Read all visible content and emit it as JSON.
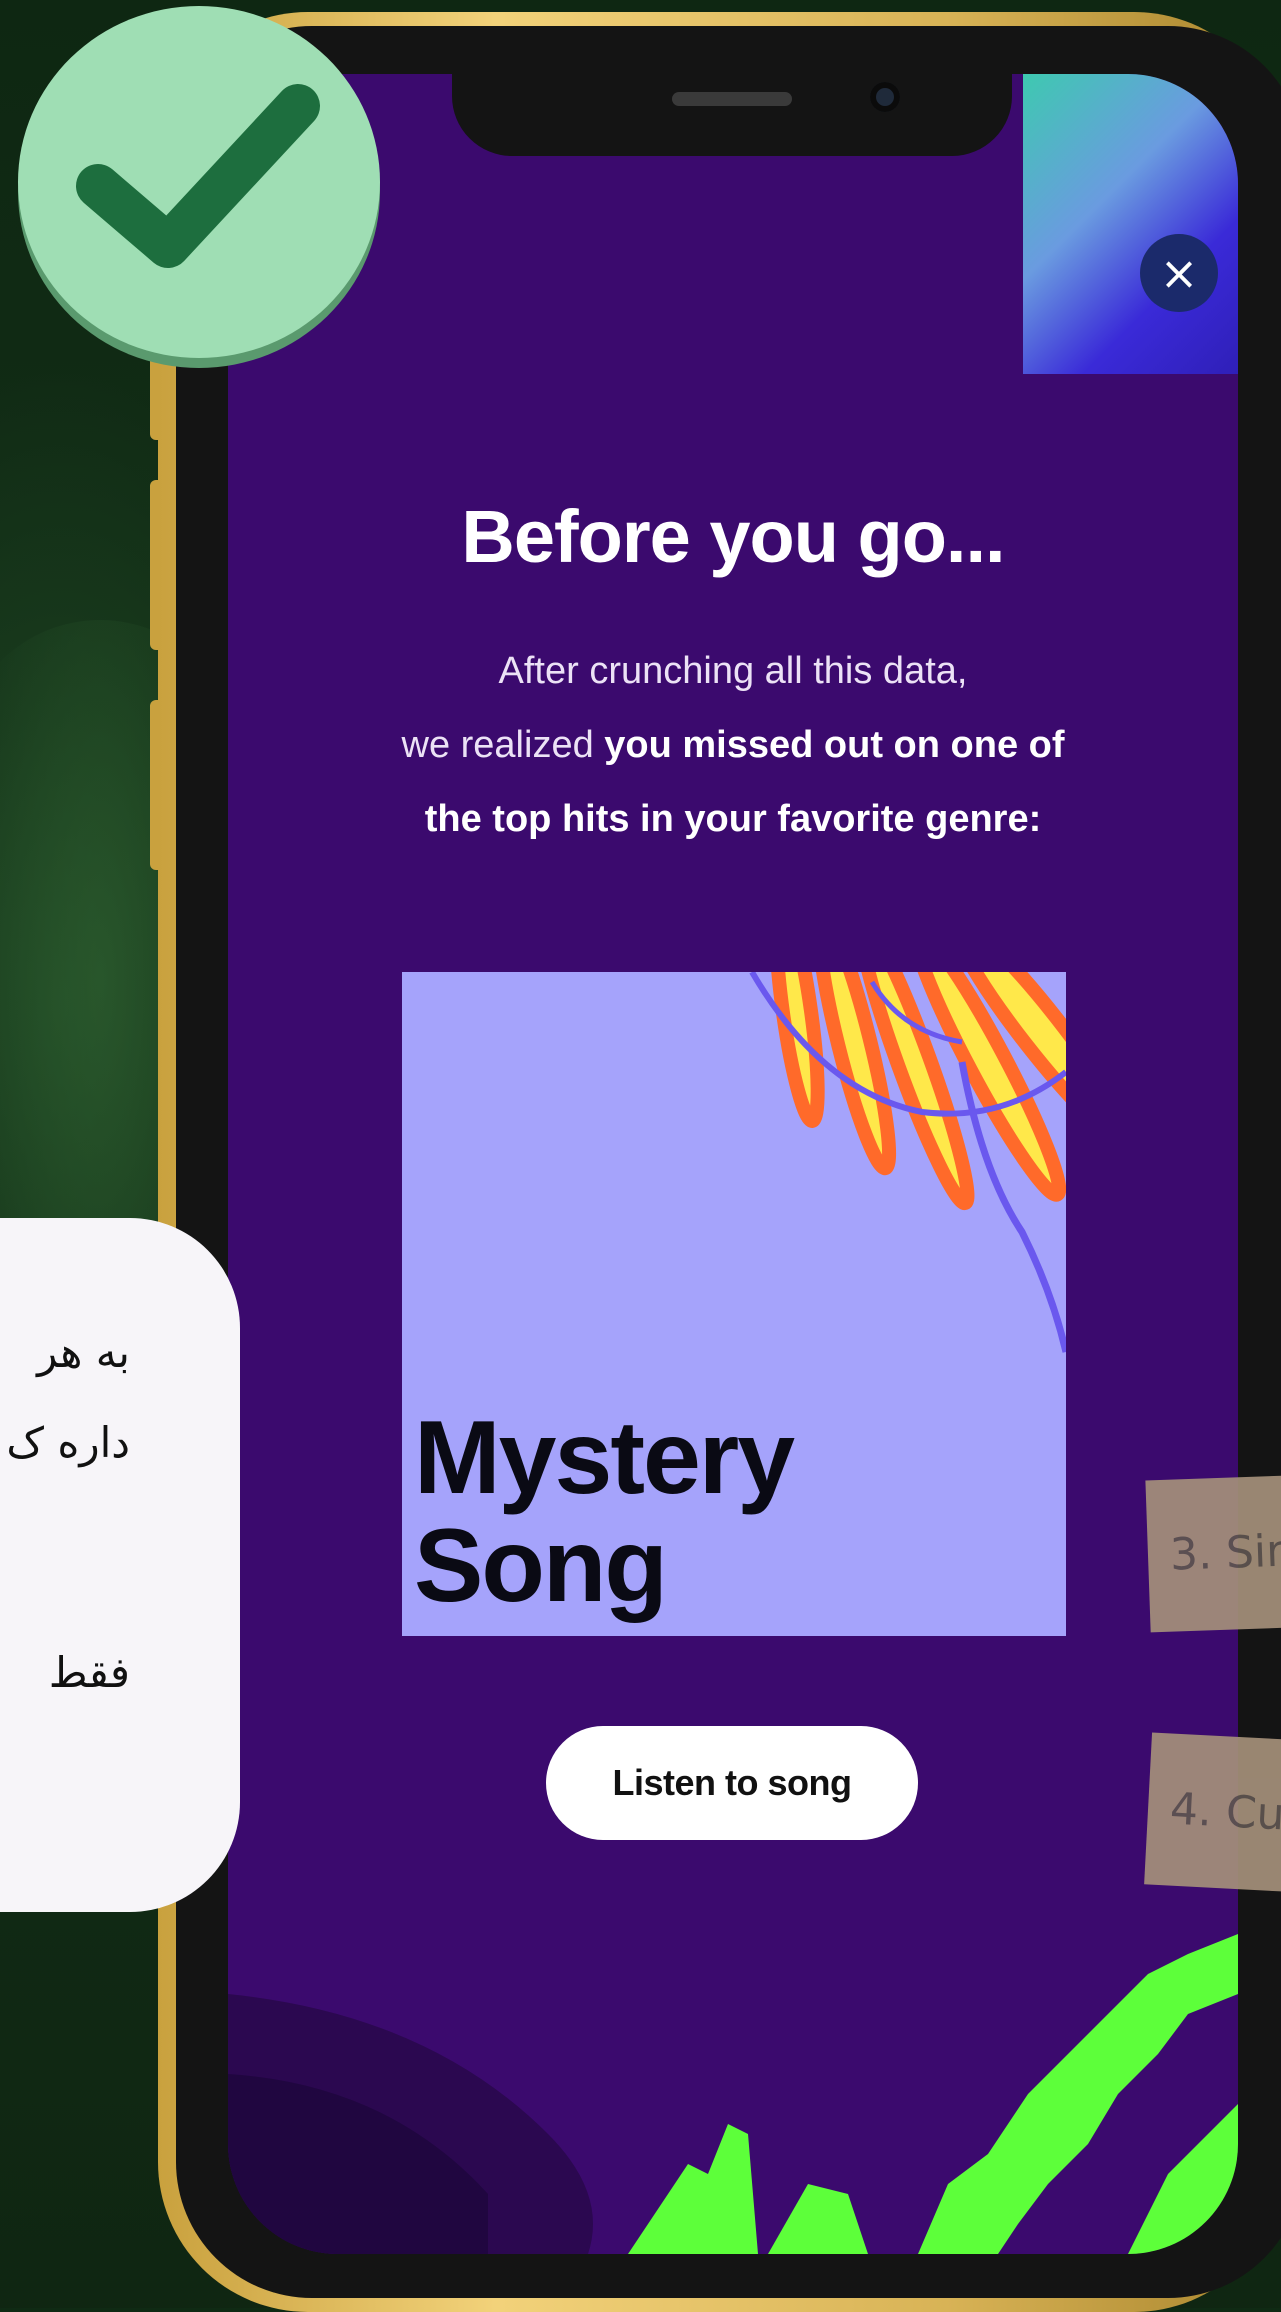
{
  "popup": {
    "title": "Before you go...",
    "subtitle_line1": "After crunching all this data,",
    "subtitle_line2_plain": "we realized ",
    "subtitle_line2_bold": "you missed out on one of",
    "subtitle_line3_bold": "the top hits in your favorite genre:",
    "close_glyph": "×",
    "cover": {
      "title_line1": "Mystery",
      "title_line2": "Song"
    },
    "listen_label": "Listen to song"
  },
  "side_card": {
    "line1": "به هر",
    "line2": "داره ک",
    "line3": "فقط"
  },
  "stamps": {
    "item3": "3. Sir",
    "item4": "4. Cu"
  },
  "colors": {
    "screen_bg": "#3b0a6e",
    "cover_bg": "#a5a3fb",
    "check_bg": "#9fdeb4",
    "check_mark": "#1d6e3e",
    "accent_green": "#5dff3a"
  },
  "icons": {
    "check": "check-icon",
    "close": "close-icon"
  }
}
